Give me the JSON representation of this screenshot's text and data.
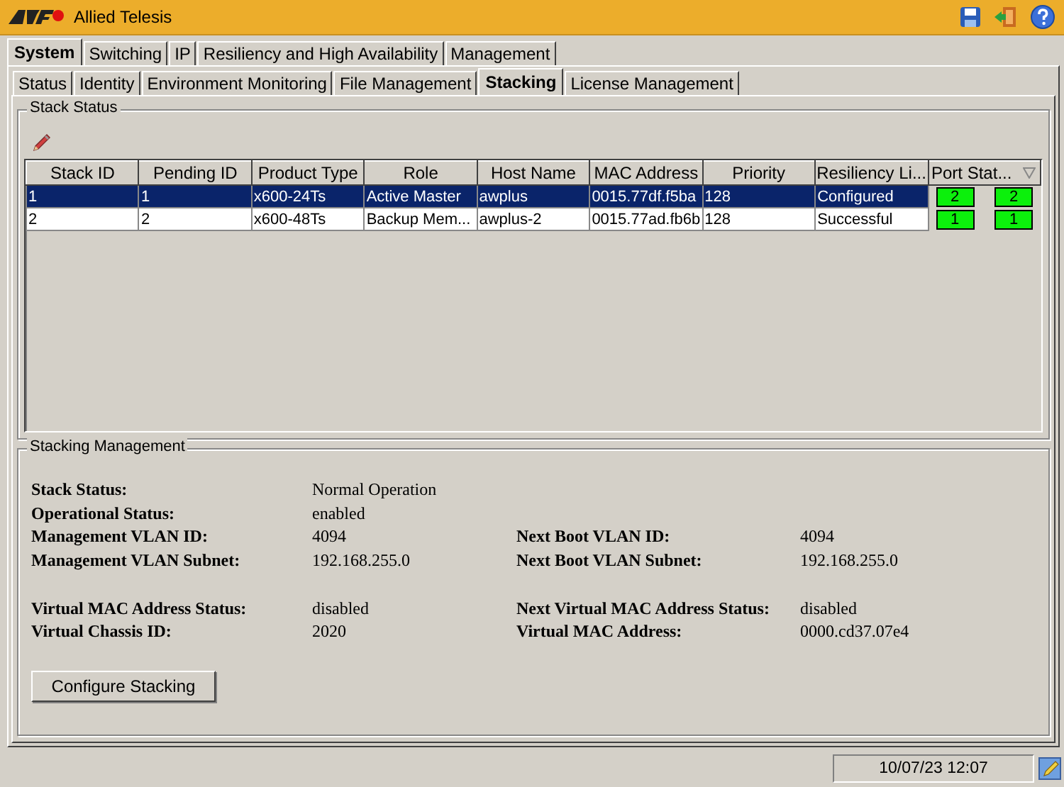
{
  "window": {
    "title": "Allied Telesis"
  },
  "main_tabs": [
    {
      "label": "System",
      "selected": true
    },
    {
      "label": "Switching",
      "selected": false
    },
    {
      "label": "IP",
      "selected": false
    },
    {
      "label": "Resiliency and High Availability",
      "selected": false
    },
    {
      "label": "Management",
      "selected": false
    }
  ],
  "sub_tabs": [
    {
      "label": "Status",
      "selected": false
    },
    {
      "label": "Identity",
      "selected": false
    },
    {
      "label": "Environment Monitoring",
      "selected": false
    },
    {
      "label": "File Management",
      "selected": false
    },
    {
      "label": "Stacking",
      "selected": true
    },
    {
      "label": "License Management",
      "selected": false
    }
  ],
  "stack_status": {
    "title": "Stack Status",
    "table": {
      "columns": [
        "Stack ID",
        "Pending ID",
        "Product Type",
        "Role",
        "Host Name",
        "MAC Address",
        "Priority",
        "Resiliency Li...",
        "Port Stat..."
      ],
      "rows": [
        {
          "selected": true,
          "cells": [
            "1",
            "1",
            "x600-24Ts",
            "Active Master",
            "awplus",
            "0015.77df.f5ba",
            "128",
            "Configured"
          ],
          "ports": [
            "2",
            "2"
          ]
        },
        {
          "selected": false,
          "cells": [
            "2",
            "2",
            "x600-48Ts",
            "Backup Mem...",
            "awplus-2",
            "0015.77ad.fb6b",
            "128",
            "Successful"
          ],
          "ports": [
            "1",
            "1"
          ]
        }
      ]
    }
  },
  "stacking_management": {
    "title": "Stacking Management",
    "groups": [
      [
        {
          "label": "Stack Status:",
          "value": "Normal Operation"
        },
        {
          "label": "Operational Status:",
          "value": "enabled"
        },
        {
          "label": "Management VLAN ID:",
          "value": "4094",
          "label2": "Next Boot VLAN ID:",
          "value2": "4094"
        },
        {
          "label": "Management VLAN Subnet:",
          "value": "192.168.255.0",
          "label2": "Next Boot VLAN Subnet:",
          "value2": "192.168.255.0"
        }
      ],
      [
        {
          "label": "Virtual MAC Address Status:",
          "value": "disabled",
          "label2": "Next Virtual MAC Address Status:",
          "value2": "disabled"
        },
        {
          "label": "Virtual Chassis ID:",
          "value": "2020",
          "label2": "Virtual MAC Address:",
          "value2": "0000.cd37.07e4"
        }
      ]
    ],
    "button": "Configure Stacking"
  },
  "status_bar": {
    "datetime": "10/07/23 12:07"
  }
}
